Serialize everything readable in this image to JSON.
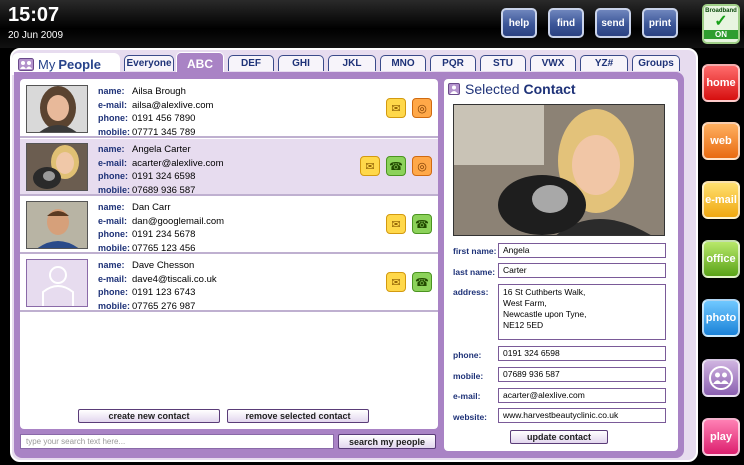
{
  "status": {
    "time": "15:07",
    "date": "20 Jun 2009"
  },
  "topbar": {
    "help": "help",
    "find": "find",
    "send": "send",
    "print": "print",
    "broadband_label": "Broadband",
    "broadband_status": "ON"
  },
  "sidebar": {
    "home": "home",
    "web": "web",
    "email": "e-mail",
    "office": "office",
    "photo": "photo",
    "play": "play"
  },
  "page": {
    "title_pre": "My",
    "title_main": "People"
  },
  "tabs": [
    "Everyone",
    "ABC",
    "DEF",
    "GHI",
    "JKL",
    "MNO",
    "PQR",
    "STU",
    "VWX",
    "YZ#",
    "Groups"
  ],
  "field_labels": {
    "name": "name:",
    "email": "e-mail:",
    "phone": "phone:",
    "mobile": "mobile:"
  },
  "contacts": [
    {
      "name": "Ailsa Brough",
      "email": "ailsa@alexlive.com",
      "phone": "0191 456 7890",
      "mobile": "07771 345 789"
    },
    {
      "name": "Angela Carter",
      "email": "acarter@alexlive.com",
      "phone": "0191 324 6598",
      "mobile": "07689 936 587"
    },
    {
      "name": "Dan Carr",
      "email": "dan@googlemail.com",
      "phone": "0191 234 5678",
      "mobile": "07765 123 456"
    },
    {
      "name": "Dave Chesson",
      "email": "dave4@tiscali.co.uk",
      "phone": "0191 123 6743",
      "mobile": "07765 276 987"
    }
  ],
  "actions": {
    "create": "create new contact",
    "remove": "remove selected contact",
    "search_btn": "search my people",
    "search_placeholder": "type your search text here...",
    "update": "update contact"
  },
  "selected": {
    "head_pre": "Selected",
    "head_main": "Contact",
    "labels": {
      "first": "first name:",
      "last": "last name:",
      "address": "address:",
      "phone": "phone:",
      "mobile": "mobile:",
      "email": "e-mail:",
      "website": "website:"
    },
    "first": "Angela",
    "last": "Carter",
    "address": "16 St Cuthberts Walk,\nWest Farm,\nNewcastle upon Tyne,\nNE12 5ED",
    "phone": "0191 324 6598",
    "mobile": "07689 936 587",
    "email": "acarter@alexlive.com",
    "website": "www.harvestbeautyclinic.co.uk"
  }
}
